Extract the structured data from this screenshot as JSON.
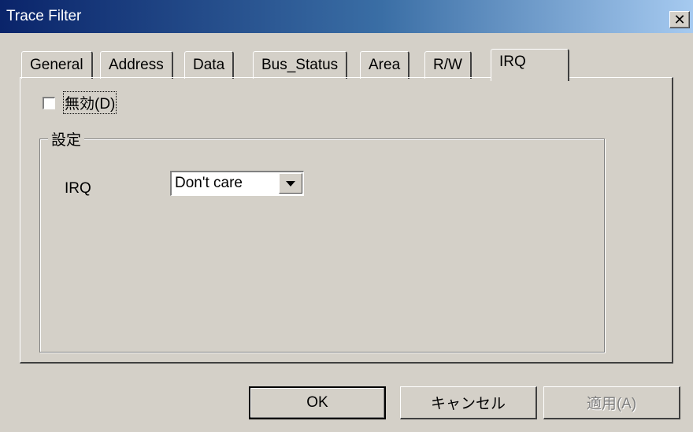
{
  "window": {
    "title": "Trace Filter",
    "close_icon": "close-icon"
  },
  "tabs": [
    {
      "label": "General",
      "active": false
    },
    {
      "label": "Address",
      "active": false
    },
    {
      "label": "Data",
      "active": false
    },
    {
      "label": "Bus_Status",
      "active": false
    },
    {
      "label": "Area",
      "active": false
    },
    {
      "label": "R/W",
      "active": false
    },
    {
      "label": "IRQ",
      "active": true
    }
  ],
  "panel": {
    "disable_checkbox": {
      "label": "無効(D)",
      "checked": false
    },
    "group": {
      "title": "設定",
      "irq_label": "IRQ",
      "irq_value": "Don't care"
    }
  },
  "buttons": {
    "ok": "OK",
    "cancel": "キャンセル",
    "apply": "適用(A)"
  },
  "colors": {
    "titlebar_start": "#0a246a",
    "titlebar_end": "#a6caf0",
    "face": "#d4d0c8"
  }
}
